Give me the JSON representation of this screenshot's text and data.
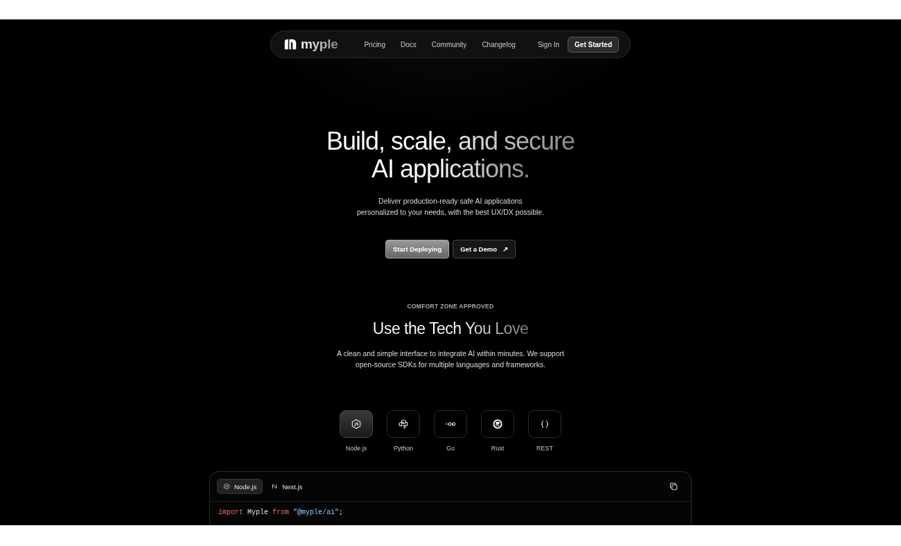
{
  "nav": {
    "logo": "myple",
    "links": [
      "Pricing",
      "Docs",
      "Community",
      "Changelog"
    ],
    "sign_in": "Sign In",
    "cta": "Get Started"
  },
  "hero": {
    "title_lines": [
      "Build, scale, and secure",
      "AI applications."
    ],
    "subtitle_lines": [
      "Deliver production-ready safe AI applications",
      "personalized to your needs, with the best UX/DX possible."
    ],
    "primary": "Start Deploying",
    "secondary": "Get a Demo",
    "secondary_icon": "↗"
  },
  "tech": {
    "eyebrow": "COMFORT ZONE APPROVED",
    "title": "Use the Tech You Love",
    "description_lines": [
      "A clean and simple interface to integrate AI within minutes. We support",
      "open-source SDKs for multiple languages and frameworks."
    ],
    "sdks": [
      {
        "kind": "node",
        "label": "Node.js",
        "selected": true
      },
      {
        "kind": "python",
        "label": "Python",
        "selected": false
      },
      {
        "kind": "go",
        "label": "Go",
        "selected": false
      },
      {
        "kind": "rust",
        "label": "Rust",
        "selected": false
      },
      {
        "kind": "rest",
        "label": "REST",
        "selected": false
      }
    ]
  },
  "code": {
    "tabs": [
      {
        "kind": "node",
        "label": "Node.js",
        "selected": true
      },
      {
        "kind": "next",
        "label": "Next.js",
        "selected": false
      }
    ],
    "tokens": [
      {
        "kind": "keyword",
        "text": "import"
      },
      {
        "kind": "plain",
        "text": " Myple "
      },
      {
        "kind": "keyword",
        "text": "from"
      },
      {
        "kind": "string",
        "text": " \"@myple/ai\""
      },
      {
        "kind": "plain",
        "text": ";"
      }
    ]
  }
}
